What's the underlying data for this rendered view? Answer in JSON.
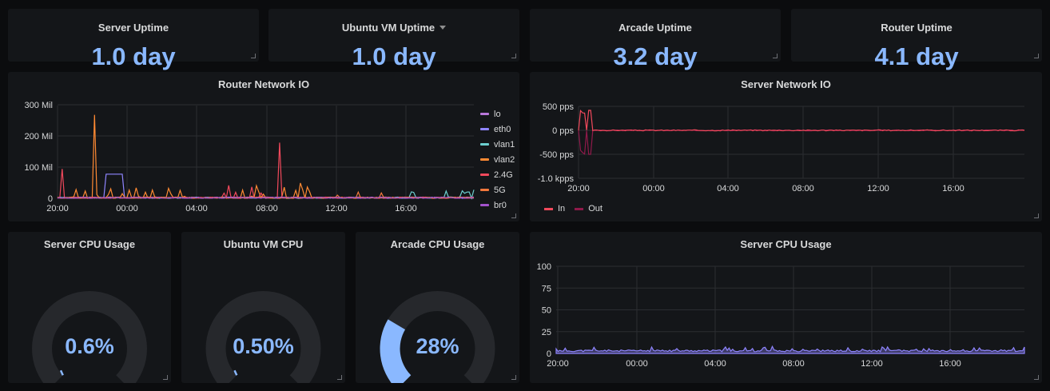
{
  "stats": [
    {
      "title": "Server Uptime",
      "value": "1.0 day",
      "dropdown": false
    },
    {
      "title": "Ubuntu VM Uptime",
      "value": "1.0 day",
      "dropdown": true
    },
    {
      "title": "Arcade Uptime",
      "value": "3.2 day",
      "dropdown": false
    },
    {
      "title": "Router Uptime",
      "value": "4.1 day",
      "dropdown": false
    }
  ],
  "gauges": [
    {
      "title": "Server CPU Usage",
      "value": "0.6%",
      "percent": 0.6
    },
    {
      "title": "Ubuntu VM CPU",
      "value": "0.50%",
      "percent": 0.5
    },
    {
      "title": "Arcade CPU Usage",
      "value": "28%",
      "percent": 28
    }
  ],
  "colors": {
    "accent": "#8ab8ff",
    "panel": "#141619",
    "background": "#0b0c0e"
  },
  "chart_data": [
    {
      "type": "line",
      "title": "Router Network IO",
      "x_ticks": [
        "20:00",
        "00:00",
        "04:00",
        "08:00",
        "12:00",
        "16:00"
      ],
      "y_ticks": [
        "0",
        "100 Mil",
        "200 Mil",
        "300 Mil"
      ],
      "ylim": [
        0,
        300
      ],
      "legend_position": "right",
      "series": [
        {
          "name": "lo",
          "color": "#b877d9"
        },
        {
          "name": "eth0",
          "color": "#8f85ff"
        },
        {
          "name": "vlan1",
          "color": "#6ccfcf"
        },
        {
          "name": "vlan2",
          "color": "#ff8a33"
        },
        {
          "name": "2.4G",
          "color": "#f2495c"
        },
        {
          "name": "5G",
          "color": "#f2783c"
        },
        {
          "name": "br0",
          "color": "#a352cc"
        }
      ]
    },
    {
      "type": "line",
      "title": "Server Network IO",
      "x_ticks": [
        "20:00",
        "00:00",
        "04:00",
        "08:00",
        "12:00",
        "16:00"
      ],
      "y_ticks": [
        "500 pps",
        "0 pps",
        "-500 pps",
        "-1.0 kpps"
      ],
      "legend_position": "bottom",
      "series": [
        {
          "name": "In",
          "color": "#f2495c"
        },
        {
          "name": "Out",
          "color": "#8f1a4a"
        }
      ]
    },
    {
      "type": "area",
      "title": "Server CPU Usage",
      "x_ticks": [
        "20:00",
        "00:00",
        "04:00",
        "08:00",
        "12:00",
        "16:00"
      ],
      "y_ticks": [
        "0",
        "25",
        "50",
        "75",
        "100"
      ],
      "ylim": [
        0,
        100
      ],
      "series": [
        {
          "color": "#8f85ff",
          "typical_value": 2
        }
      ]
    }
  ]
}
